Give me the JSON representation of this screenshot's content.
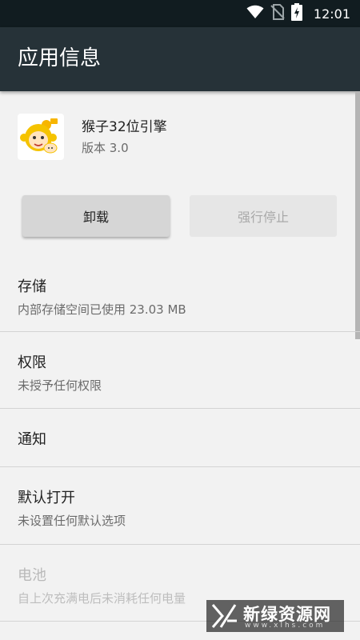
{
  "status_bar": {
    "time": "12:01",
    "icons": [
      "wifi-icon",
      "no-sim-icon",
      "battery-charging-icon"
    ]
  },
  "app_bar": {
    "title": "应用信息"
  },
  "app": {
    "name": "猴子32位引擎",
    "version": "版本 3.0",
    "icon": "monkey-app-icon"
  },
  "buttons": {
    "uninstall": "卸载",
    "force_stop": "强行停止"
  },
  "sections": {
    "storage": {
      "title": "存储",
      "subtitle": "内部存储空间已使用 23.03 MB"
    },
    "permissions": {
      "title": "权限",
      "subtitle": "未授予任何权限"
    },
    "notifications": {
      "title": "通知"
    },
    "open_by_default": {
      "title": "默认打开",
      "subtitle": "未设置任何默认选项"
    },
    "battery": {
      "title": "电池",
      "subtitle": "自上次充满电后未消耗任何电量"
    }
  },
  "watermark": {
    "name": "新绿资源网",
    "url": "www.xlhs.com"
  },
  "colors": {
    "status_bar": "#111c20",
    "app_bar": "#263238",
    "background": "#f2f2f2",
    "divider": "#d4d4d4"
  }
}
